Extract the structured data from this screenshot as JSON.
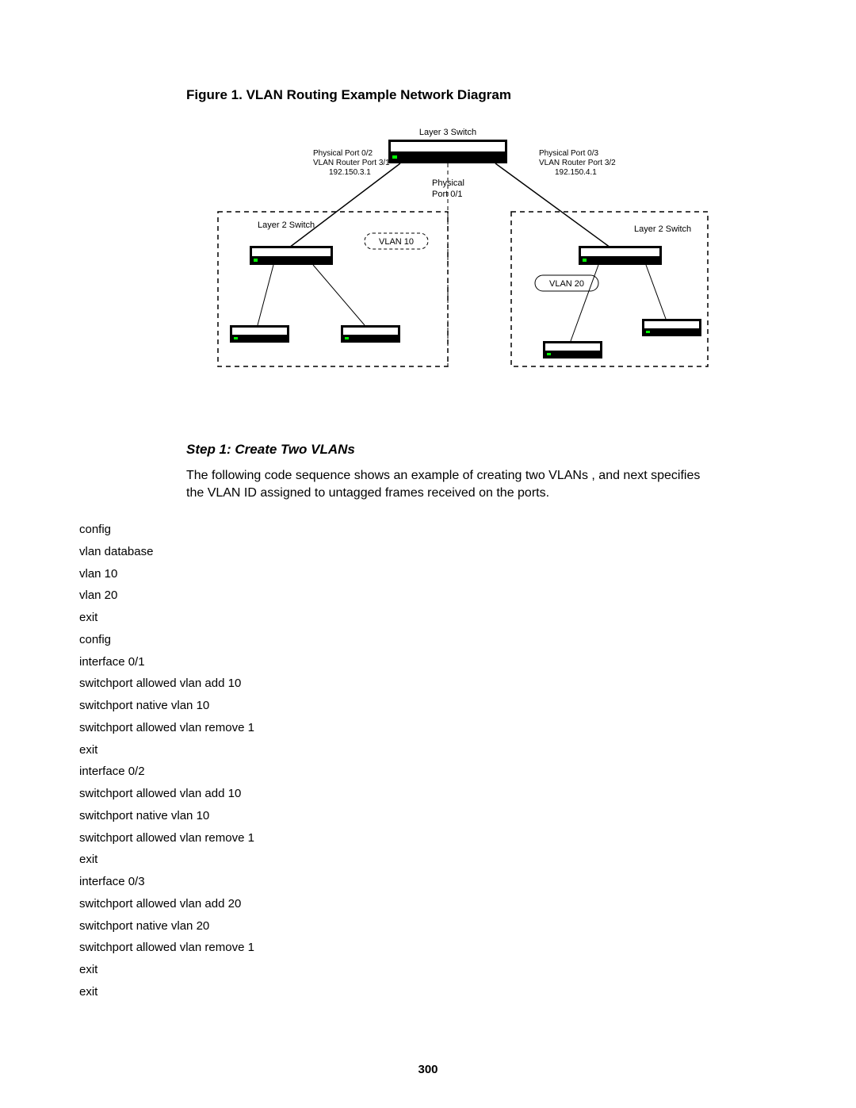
{
  "figure_title": "Figure 1. VLAN Routing Example Network Diagram",
  "diagram": {
    "l3_label": "Layer 3 Switch",
    "port_left": {
      "l1": "Physical Port   0/2",
      "l2": "VLAN Router Port 3/1",
      "l3": "192.150.3.1"
    },
    "port_right": {
      "l1": "Physical Port   0/3",
      "l2": "VLAN Router Port 3/2",
      "l3": "192.150.4.1"
    },
    "port_center": {
      "l1": "Physical",
      "l2": "Port   0/1"
    },
    "l2_left": "Layer 2 Switch",
    "l2_right": "Layer 2 Switch",
    "vlan10": "VLAN 10",
    "vlan20": "VLAN 20"
  },
  "step_title": "Step 1: Create Two VLANs",
  "step_body": "The following code sequence shows an example of creating two VLANs , and next specifies the VLAN ID assigned to untagged frames received on the ports.",
  "code": [
    "config",
    "vlan database",
    "vlan 10",
    "vlan 20",
    "exit",
    "config",
    "interface 0/1",
    "switchport allowed vlan add 10",
    "switchport native vlan 10",
    "switchport allowed vlan remove 1",
    "exit",
    "interface 0/2",
    "switchport allowed vlan add 10",
    "switchport native vlan 10",
    "switchport allowed vlan remove 1",
    "exit",
    "interface 0/3",
    "switchport allowed vlan add 20",
    "switchport native vlan 20",
    "switchport allowed vlan remove 1",
    "exit",
    "exit"
  ],
  "page_number": "300"
}
